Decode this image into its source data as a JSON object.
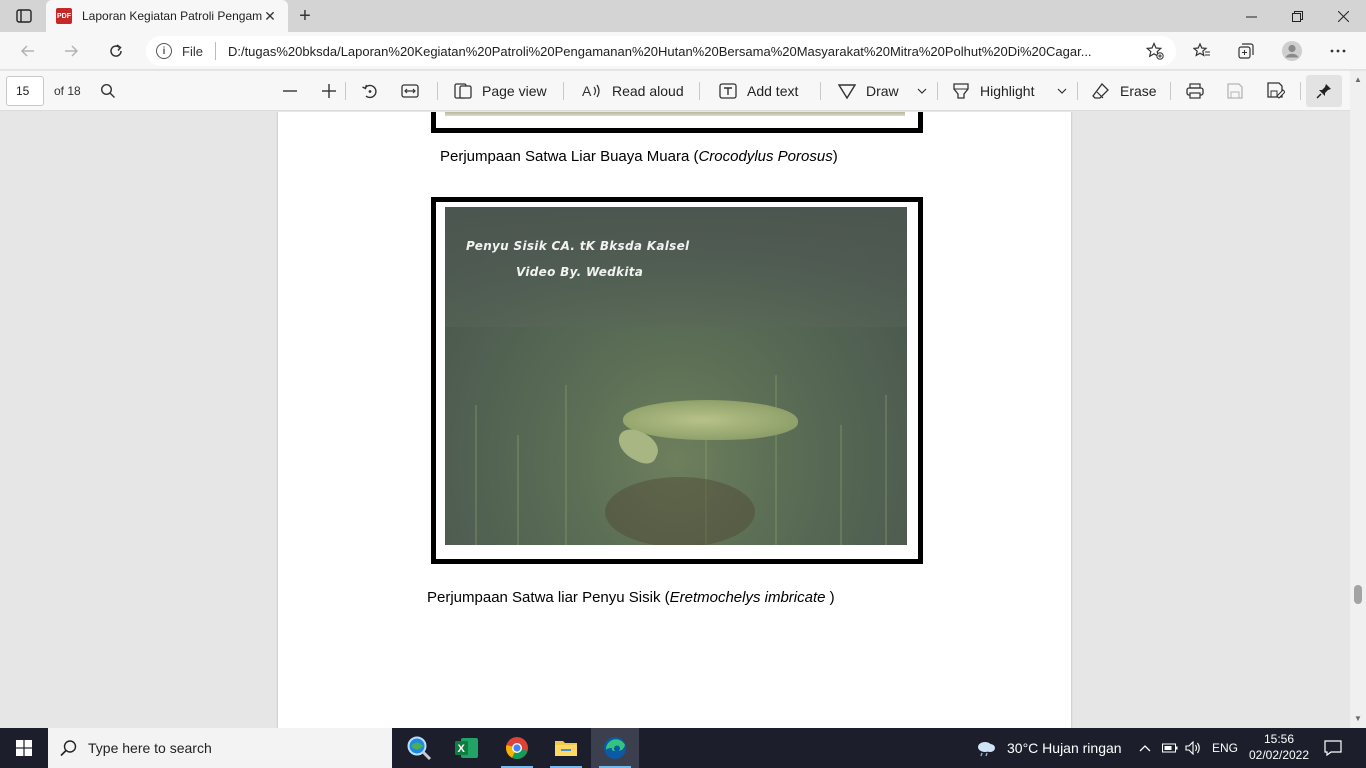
{
  "browser": {
    "tab_title": "Laporan Kegiatan Patroli Pengamanan Hutan",
    "favicon_text": "PDF",
    "address_scheme": "File",
    "url": "D:/tugas%20bksda/Laporan%20Kegiatan%20Patroli%20Pengamanan%20Hutan%20Bersama%20Masyarakat%20Mitra%20Polhut%20Di%20Cagar..."
  },
  "pdf_toolbar": {
    "page_number": "15",
    "page_total": "of 18",
    "page_view": "Page view",
    "read_aloud": "Read aloud",
    "add_text": "Add text",
    "draw": "Draw",
    "highlight": "Highlight",
    "erase": "Erase"
  },
  "document": {
    "caption1_prefix": "Perjumpaan Satwa Liar Buaya Muara (",
    "caption1_species": "Crocodylus Porosus",
    "caption1_suffix": ")",
    "photo_overlay_line1": "Penyu Sisik CA. tK Bksda Kalsel",
    "photo_overlay_line2": "Video By. Wedkita",
    "caption2_prefix": "Perjumpaan Satwa liar Penyu Sisik (",
    "caption2_species": "Eretmochelys imbricate",
    "caption2_suffix": " )"
  },
  "taskbar": {
    "search_placeholder": "Type here to search",
    "weather": "30°C  Hujan ringan",
    "language": "ENG",
    "time": "15:56",
    "date": "02/02/2022"
  }
}
